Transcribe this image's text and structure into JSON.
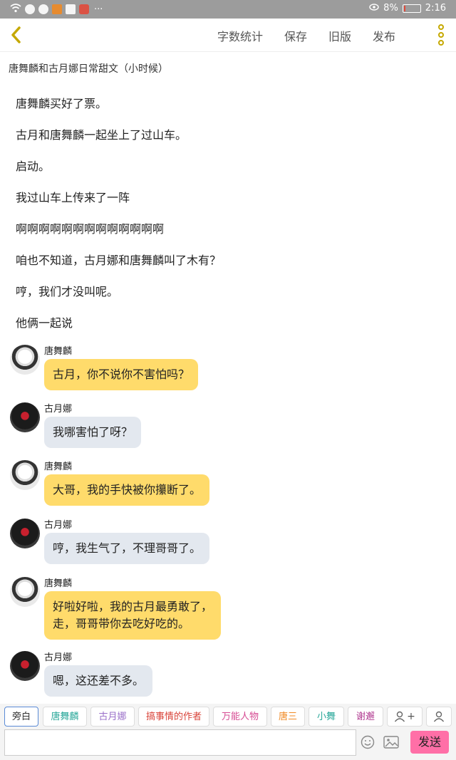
{
  "status_bar": {
    "battery_percent_text": "8%",
    "battery_level": 0.08,
    "time": "2:16",
    "more_icons_text": "···",
    "left_icons": [
      "wifi-icon",
      "k-app-icon",
      "s-app-icon",
      "play-app-icon",
      "battery-saver-icon",
      "red-app-icon"
    ]
  },
  "toolbar": {
    "word_count": "字数统计",
    "save": "保存",
    "old_version": "旧版",
    "publish": "发布"
  },
  "doc": {
    "title": "唐舞麟和古月娜日常甜文（小时候）"
  },
  "paragraphs": [
    "唐舞麟买好了票。",
    "古月和唐舞麟一起坐上了过山车。",
    "启动。",
    "我过山车上传来了一阵",
    "啊啊啊啊啊啊啊啊啊啊啊啊啊",
    "咱也不知道，古月娜和唐舞麟叫了木有？",
    "哼，我们才没叫呢。",
    "他俩一起说"
  ],
  "messages": [
    {
      "speaker": "唐舞麟",
      "lines": [
        "古月，你不说你不害怕吗？"
      ],
      "style": "yellow"
    },
    {
      "speaker": "古月娜",
      "lines": [
        "我哪害怕了呀？"
      ],
      "style": "gray"
    },
    {
      "speaker": "唐舞麟",
      "lines": [
        "大哥，我的手快被你攥断了。"
      ],
      "style": "yellow"
    },
    {
      "speaker": "古月娜",
      "lines": [
        "哼，我生气了，不理哥哥了。"
      ],
      "style": "gray"
    },
    {
      "speaker": "唐舞麟",
      "lines": [
        "好啦好啦，我的古月最勇敢了，",
        "走，哥哥带你去吃好吃的。"
      ],
      "style": "yellow"
    },
    {
      "speaker": "古月娜",
      "lines": [
        "嗯，这还差不多。"
      ],
      "style": "gray"
    }
  ],
  "roles": [
    {
      "label": "旁白",
      "color": "#333333"
    },
    {
      "label": "唐舞麟",
      "color": "#2aa89a"
    },
    {
      "label": "古月娜",
      "color": "#9a6fc9"
    },
    {
      "label": "搞事情的作者",
      "color": "#d9443a"
    },
    {
      "label": "万能人物",
      "color": "#d64b93"
    },
    {
      "label": "唐三",
      "color": "#f08a24"
    },
    {
      "label": "小舞",
      "color": "#2aa89a"
    },
    {
      "label": "谢邂",
      "color": "#b0378f"
    }
  ],
  "add_role_plus": "+",
  "input": {
    "placeholder": "",
    "send": "发送"
  },
  "colors": {
    "accent_yellow": "#ffdb6b",
    "bubble_gray": "#e3e8ef",
    "send_pink": "#ff6fa7",
    "more_icon": "#c5a800"
  }
}
